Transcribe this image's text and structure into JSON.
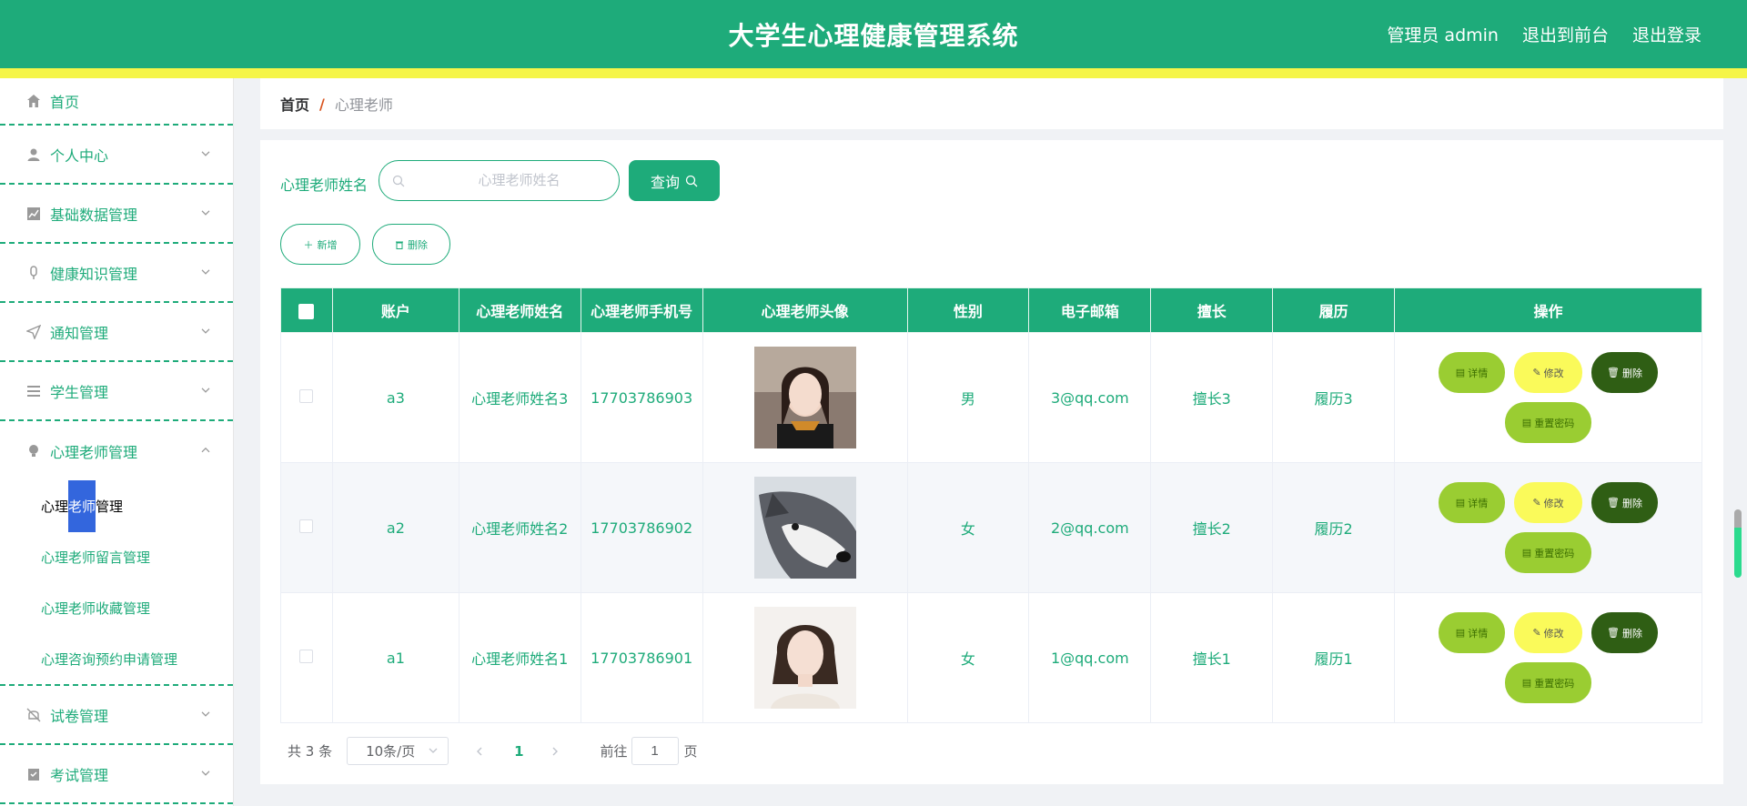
{
  "header": {
    "title": "大学生心理健康管理系统",
    "user": "管理员 admin",
    "to_front": "退出到前台",
    "logout": "退出登录"
  },
  "sidebar": {
    "items": [
      {
        "label": "首页",
        "icon": "home-icon"
      },
      {
        "label": "个人中心",
        "icon": "user-icon"
      },
      {
        "label": "基础数据管理",
        "icon": "chart-icon"
      },
      {
        "label": "健康知识管理",
        "icon": "microphone-icon"
      },
      {
        "label": "通知管理",
        "icon": "send-icon"
      },
      {
        "label": "学生管理",
        "icon": "list-icon"
      },
      {
        "label": "心理老师管理",
        "icon": "bulb-icon"
      },
      {
        "label": "试卷管理",
        "icon": "bell-off-icon"
      },
      {
        "label": "考试管理",
        "icon": "clipboard-icon"
      }
    ],
    "submenu": {
      "active_pre": "心理",
      "active_hl": "老师",
      "active_post": "管理",
      "items": [
        "心理老师留言管理",
        "心理老师收藏管理",
        "心理咨询预约申请管理"
      ]
    }
  },
  "breadcrumb": {
    "home": "首页",
    "sep": "/",
    "current": "心理老师"
  },
  "search": {
    "label": "心理老师姓名",
    "placeholder": "心理老师姓名",
    "button": "查询"
  },
  "actions": {
    "add": "新增",
    "delete": "删除"
  },
  "table": {
    "columns": [
      "账户",
      "心理老师姓名",
      "心理老师手机号",
      "心理老师头像",
      "性别",
      "电子邮箱",
      "擅长",
      "履历",
      "操作"
    ],
    "rows": [
      {
        "account": "a3",
        "name": "心理老师姓名3",
        "phone": "17703786903",
        "gender": "男",
        "email": "3@qq.com",
        "specialty": "擅长3",
        "resume": "履历3"
      },
      {
        "account": "a2",
        "name": "心理老师姓名2",
        "phone": "17703786902",
        "gender": "女",
        "email": "2@qq.com",
        "specialty": "擅长2",
        "resume": "履历2"
      },
      {
        "account": "a1",
        "name": "心理老师姓名1",
        "phone": "17703786901",
        "gender": "女",
        "email": "1@qq.com",
        "specialty": "擅长1",
        "resume": "履历1"
      }
    ],
    "ops": {
      "detail": "详情",
      "edit": "修改",
      "delete": "删除",
      "reset": "重置密码"
    }
  },
  "pager": {
    "total": "共 3 条",
    "page_size": "10条/页",
    "current": "1",
    "goto": "前往",
    "goto_value": "1",
    "unit": "页"
  },
  "colors": {
    "primary": "#1eab7a",
    "accent_yellow": "#f5f548",
    "detail": "#9acd32",
    "edit": "#fafa5a",
    "delete": "#2f5e14"
  }
}
